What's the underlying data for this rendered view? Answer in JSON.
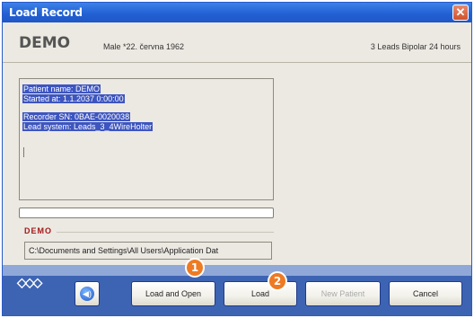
{
  "window": {
    "title": "Load Record",
    "close_glyph": "✕"
  },
  "header": {
    "patient_name": "DEMO",
    "patient_info": "Male *22. června 1962",
    "leads_info": "3 Leads Bipolar 24 hours"
  },
  "record_info": {
    "lines": [
      "Patient name: DEMO",
      "Started at: 1.1.2037 0:00:00",
      "",
      "Recorder SN: 0BAE-0020038",
      "Lead system: Leads_3_4WireHolter"
    ]
  },
  "progress": {
    "value": 0
  },
  "group": {
    "label": "DEMO",
    "path": "C:\\Documents and Settings\\All Users\\Application Dat"
  },
  "footer": {
    "logo_glyph": "◇◇◇",
    "speaker_glyph": "◀)",
    "buttons": {
      "load_and_open": "Load and Open",
      "load": "Load",
      "new_patient": "New Patient",
      "cancel": "Cancel"
    }
  },
  "steps": {
    "one": "1",
    "two": "2"
  },
  "colors": {
    "titlebar": "#2361d4",
    "footer": "#3d64b3",
    "selection": "#3d55c0",
    "group_label": "#a31818",
    "step_badge": "#ee7a23"
  }
}
